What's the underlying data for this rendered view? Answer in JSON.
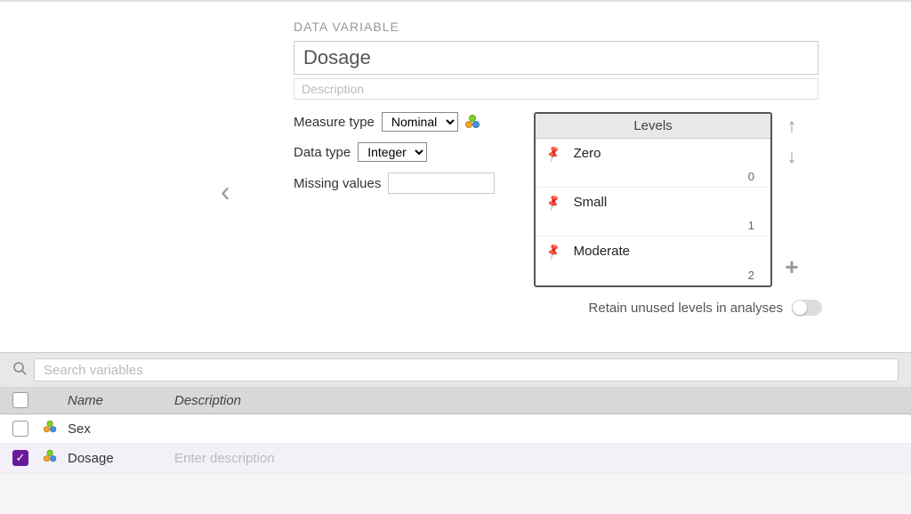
{
  "editor": {
    "section_title": "DATA VARIABLE",
    "name_value": "Dosage",
    "desc_placeholder": "Description",
    "measure_type_label": "Measure type",
    "measure_type_value": "Nominal",
    "data_type_label": "Data type",
    "data_type_value": "Integer",
    "missing_values_label": "Missing values",
    "missing_values_value": "",
    "levels_header": "Levels",
    "levels": [
      {
        "label": "Zero",
        "value": "0"
      },
      {
        "label": "Small",
        "value": "1"
      },
      {
        "label": "Moderate",
        "value": "2"
      }
    ],
    "retain_label": "Retain unused levels in analyses"
  },
  "search": {
    "placeholder": "Search variables"
  },
  "table": {
    "name_header": "Name",
    "desc_header": "Description",
    "rows": [
      {
        "checked": false,
        "name": "Sex",
        "desc": ""
      },
      {
        "checked": true,
        "name": "Dosage",
        "desc": "",
        "desc_placeholder": "Enter description"
      }
    ]
  }
}
